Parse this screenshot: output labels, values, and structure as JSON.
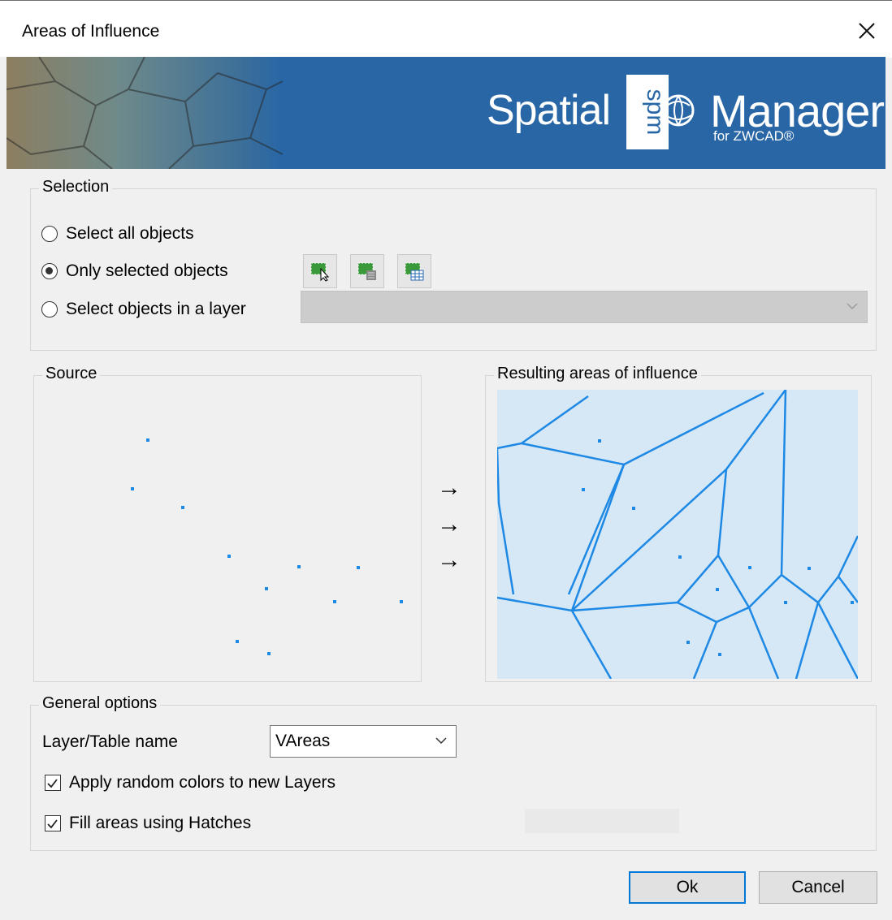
{
  "window": {
    "title": "Areas of Influence"
  },
  "banner": {
    "brand_left": "Spatial",
    "logo_text": "spm",
    "brand_right": "Manager",
    "brand_sub": "for ZWCAD®"
  },
  "selection": {
    "legend": "Selection",
    "options": [
      {
        "label": "Select all objects",
        "selected": false
      },
      {
        "label": "Only selected objects",
        "selected": true
      },
      {
        "label": "Select objects in a layer",
        "selected": false
      }
    ],
    "layer_dropdown_value": ""
  },
  "preview": {
    "source_legend": "Source",
    "result_legend": "Resulting areas of influence",
    "accent_color": "#1e88e5",
    "fill_color": "#d6e8f5"
  },
  "general": {
    "legend": "General options",
    "layer_label": "Layer/Table name",
    "layer_value": "VAreas",
    "random_colors": {
      "label": "Apply random colors to new Layers",
      "checked": true
    },
    "fill_hatches": {
      "label": "Fill areas using Hatches",
      "checked": true
    }
  },
  "buttons": {
    "ok": "Ok",
    "cancel": "Cancel"
  }
}
